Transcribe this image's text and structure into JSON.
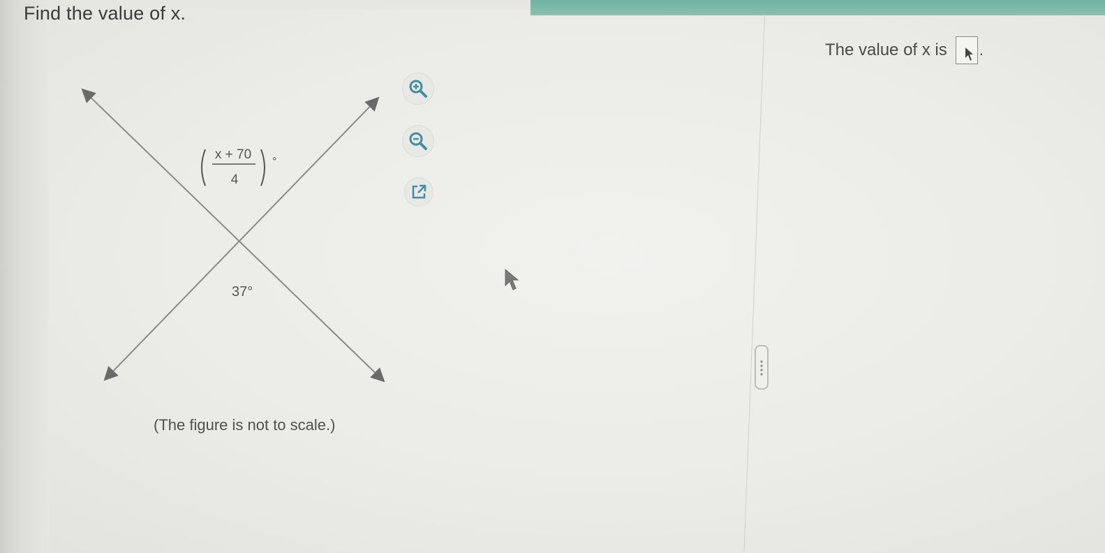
{
  "question": {
    "text": "Find the value of x."
  },
  "figure": {
    "angle_top_numerator": "x + 70",
    "angle_top_denominator": "4",
    "angle_top_degree": "°",
    "angle_bottom_label": "37°",
    "caption": "(The figure is not to scale.)"
  },
  "tools": {
    "zoom_in_icon": "zoom-in-icon",
    "zoom_out_icon": "zoom-out-icon",
    "popout_icon": "external-link-icon"
  },
  "answer": {
    "prompt": "The value of x is",
    "value": "",
    "suffix": "."
  },
  "colors": {
    "header_accent": "#6fb29f",
    "tool_icon": "#3f8fa0"
  }
}
